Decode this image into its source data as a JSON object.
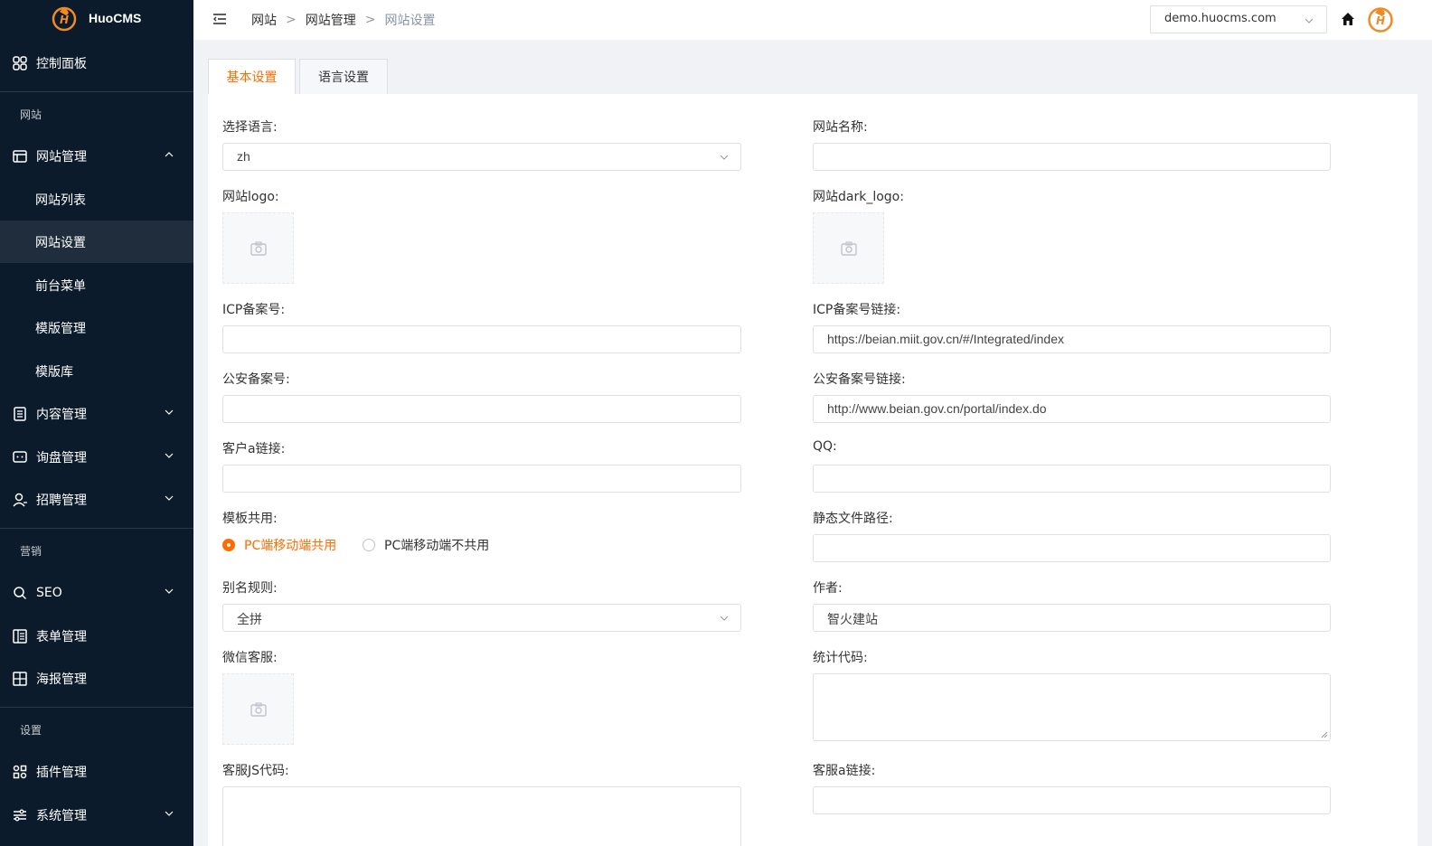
{
  "app": {
    "name": "HuoCMS"
  },
  "sidebar": {
    "dashboard": "控制面板",
    "group_site": "网站",
    "site_manage": "网站管理",
    "site_list": "网站列表",
    "site_settings": "网站设置",
    "front_menu": "前台菜单",
    "template_manage": "模版管理",
    "template_lib": "模版库",
    "content_manage": "内容管理",
    "inquiry_manage": "询盘管理",
    "recruit_manage": "招聘管理",
    "group_marketing": "营销",
    "seo": "SEO",
    "form_manage": "表单管理",
    "poster_manage": "海报管理",
    "group_settings": "设置",
    "plugin_manage": "插件管理",
    "system_manage": "系统管理"
  },
  "header": {
    "breadcrumb": [
      "网站",
      "网站管理",
      "网站设置"
    ],
    "breadcrumb_sep": ">",
    "site_domain": "demo.huocms.com"
  },
  "tabs": [
    "基本设置",
    "语言设置"
  ],
  "form": {
    "language_label": "选择语言:",
    "language_value": "zh",
    "site_name_label": "网站名称:",
    "site_name_value": "",
    "logo_label": "网站logo:",
    "dark_logo_label": "网站dark_logo:",
    "icp_label": "ICP备案号:",
    "icp_value": "",
    "icp_link_label": "ICP备案号链接:",
    "icp_link_value": "https://beian.miit.gov.cn/#/Integrated/index",
    "police_label": "公安备案号:",
    "police_value": "",
    "police_link_label": "公安备案号链接:",
    "police_link_value": "http://www.beian.gov.cn/portal/index.do",
    "customer_link_label": "客户a链接:",
    "customer_link_value": "",
    "qq_label": "QQ:",
    "qq_value": "",
    "template_share_label": "模板共用:",
    "share_option_1": "PC端移动端共用",
    "share_option_2": "PC端移动端不共用",
    "static_path_label": "静态文件路径:",
    "static_path_value": "",
    "alias_label": "别名规则:",
    "alias_value": "全拼",
    "author_label": "作者:",
    "author_value": "智火建站",
    "wechat_label": "微信客服:",
    "stats_label": "统计代码:",
    "cs_js_label": "客服JS代码:",
    "cs_link_label": "客服a链接:",
    "cs_link_value": ""
  }
}
